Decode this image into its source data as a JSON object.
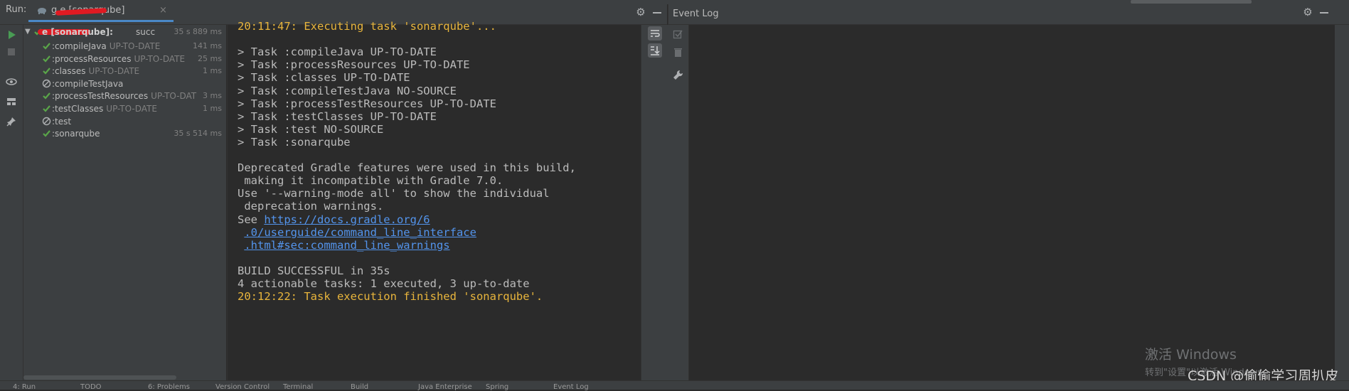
{
  "run_panel": {
    "label": "Run:",
    "tab_title": "g          e [sonarqube]",
    "tab_close": "×"
  },
  "tree": {
    "root": {
      "name": "     e [sonarqube]:",
      "status": "succ",
      "time": "35 s 889 ms"
    },
    "items": [
      {
        "name": ":compileJava",
        "status": "UP-TO-DATE",
        "time": "141 ms",
        "state": "success"
      },
      {
        "name": ":processResources",
        "status": "UP-TO-DATE",
        "time": "25 ms",
        "state": "success"
      },
      {
        "name": ":classes",
        "status": "UP-TO-DATE",
        "time": "1 ms",
        "state": "success"
      },
      {
        "name": ":compileTestJava",
        "status": "",
        "time": "",
        "state": "skipped"
      },
      {
        "name": ":processTestResources",
        "status": "UP-TO-DAT",
        "time": "3 ms",
        "state": "success"
      },
      {
        "name": ":testClasses",
        "status": "UP-TO-DATE",
        "time": "1 ms",
        "state": "success"
      },
      {
        "name": ":test",
        "status": "",
        "time": "",
        "state": "skipped"
      },
      {
        "name": ":sonarqube",
        "status": "",
        "time": "35 s 514 ms",
        "state": "success"
      }
    ]
  },
  "console": {
    "lines": [
      {
        "text": "20:11:47: Executing task 'sonarqube'...",
        "style": "orange"
      },
      {
        "text": "",
        "style": "normal"
      },
      {
        "text": "> Task :compileJava UP-TO-DATE",
        "style": "normal"
      },
      {
        "text": "> Task :processResources UP-TO-DATE",
        "style": "normal"
      },
      {
        "text": "> Task :classes UP-TO-DATE",
        "style": "normal"
      },
      {
        "text": "> Task :compileTestJava NO-SOURCE",
        "style": "normal"
      },
      {
        "text": "> Task :processTestResources UP-TO-DATE",
        "style": "normal"
      },
      {
        "text": "> Task :testClasses UP-TO-DATE",
        "style": "normal"
      },
      {
        "text": "> Task :test NO-SOURCE",
        "style": "normal"
      },
      {
        "text": "> Task :sonarqube",
        "style": "normal"
      },
      {
        "text": "",
        "style": "normal"
      },
      {
        "text": "Deprecated Gradle features were used in this build,",
        "style": "normal"
      },
      {
        "text": " making it incompatible with Gradle 7.0.",
        "style": "normal"
      },
      {
        "text": "Use '--warning-mode all' to show the individual",
        "style": "normal"
      },
      {
        "text": " deprecation warnings.",
        "style": "normal"
      },
      {
        "text": "See ",
        "style": "normal",
        "link": "https://docs.gradle.org/6"
      },
      {
        "text": " ",
        "style": "normal",
        "link": ".0/userguide/command_line_interface"
      },
      {
        "text": " ",
        "style": "normal",
        "link": ".html#sec:command_line_warnings"
      },
      {
        "text": "",
        "style": "normal"
      },
      {
        "text": "BUILD SUCCESSFUL in 35s",
        "style": "normal"
      },
      {
        "text": "4 actionable tasks: 1 executed, 3 up-to-date",
        "style": "normal"
      },
      {
        "text": "20:12:22: Task execution finished 'sonarqube'.",
        "style": "orange"
      }
    ]
  },
  "event_log": {
    "title": "Event Log"
  },
  "watermarks": {
    "windows_title": "激活 Windows",
    "windows_sub": "转到\"设置\"以激活 Windows。",
    "csdn": "CSDN @偷偷学习周扒皮"
  },
  "status_bar": {
    "items": [
      "4: Run",
      "TODO",
      "6: Problems",
      "Version Control",
      "Terminal",
      "Build",
      "Java Enterprise",
      "Spring",
      "Event Log"
    ]
  },
  "colors": {
    "accent": "#4a88c7",
    "success": "#5aa649",
    "orange_text": "#e8b53c",
    "link": "#5394ec",
    "redaction": "#e01a22"
  }
}
